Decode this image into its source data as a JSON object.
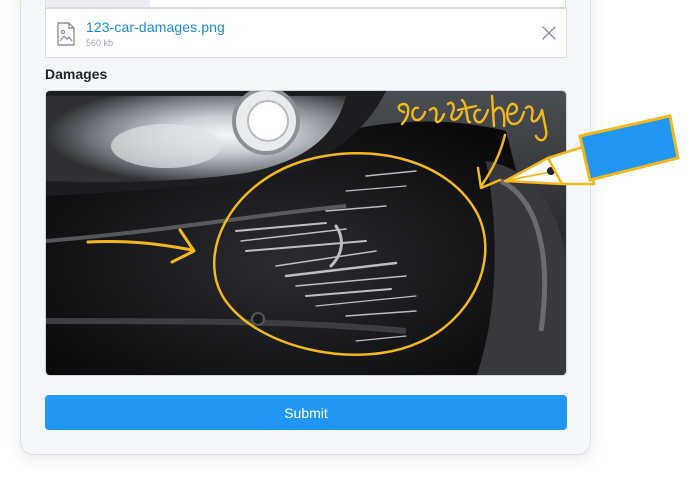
{
  "upload": {
    "progress_fraction": 0.2,
    "file_name": "123-car-damages.png",
    "file_size": "560 kb",
    "file_icon": "image-file-icon",
    "remove_icon": "close-icon"
  },
  "damages": {
    "label": "Damages",
    "annotation_text": "scratches",
    "annotation_color": "#f3b81b"
  },
  "form": {
    "submit_label": "Submit"
  },
  "colors": {
    "accent": "#2196f3",
    "link": "#1e88d9",
    "pen": "#2196f3",
    "ink": "#f3b81b"
  }
}
